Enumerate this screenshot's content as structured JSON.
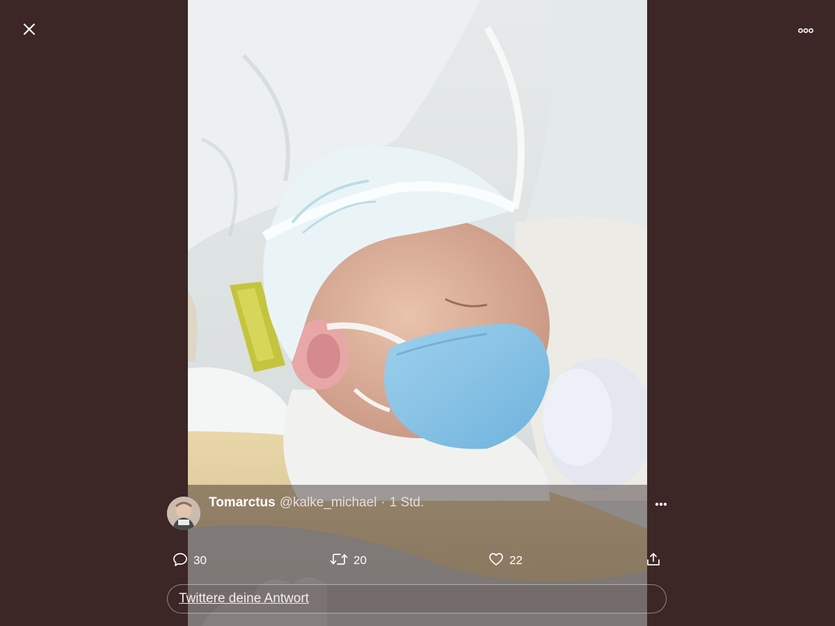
{
  "viewer": {
    "background_color": "#3d2626",
    "close_icon": "close-icon",
    "more_icon": "more-horizontal-icon"
  },
  "tweet": {
    "display_name": "Tomarctus",
    "handle": "@kalke_michael",
    "separator": "·",
    "timestamp": "1 Std.",
    "more_icon": "more-horizontal-icon"
  },
  "actions": {
    "reply": {
      "icon": "reply-icon",
      "count": "30"
    },
    "retweet": {
      "icon": "retweet-icon",
      "count": "20"
    },
    "like": {
      "icon": "heart-icon",
      "count": "22"
    },
    "share": {
      "icon": "share-icon"
    }
  },
  "reply_box": {
    "placeholder": "Twittere deine Antwort"
  }
}
